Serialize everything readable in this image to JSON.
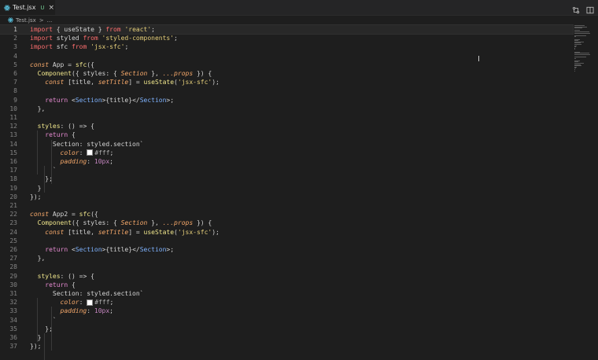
{
  "tab": {
    "filename": "Test.jsx",
    "status": "U",
    "close": "×",
    "icon": "react-icon"
  },
  "tab_actions": [
    {
      "icon": "compare-changes-icon"
    },
    {
      "icon": "split-editor-icon"
    }
  ],
  "breadcrumb": {
    "icon": "react-icon",
    "filename": "Test.jsx",
    "separator": ">",
    "more": "..."
  },
  "editor": {
    "current_line": 1
  },
  "lines": [
    [
      [
        "kw",
        "import"
      ],
      [
        "var",
        " { useState } "
      ],
      [
        "kw",
        "from"
      ],
      [
        "var",
        " "
      ],
      [
        "str",
        "'react'"
      ],
      [
        "var",
        ";"
      ]
    ],
    [
      [
        "kw",
        "import"
      ],
      [
        "var",
        " styled "
      ],
      [
        "kw",
        "from"
      ],
      [
        "var",
        " "
      ],
      [
        "str",
        "'styled-components'"
      ],
      [
        "var",
        ";"
      ]
    ],
    [
      [
        "kw",
        "import"
      ],
      [
        "var",
        " sfc "
      ],
      [
        "kw",
        "from"
      ],
      [
        "var",
        " "
      ],
      [
        "str",
        "'jsx-sfc'"
      ],
      [
        "var",
        ";"
      ]
    ],
    [],
    [
      [
        "it",
        "const"
      ],
      [
        "var",
        " App = "
      ],
      [
        "fn",
        "sfc"
      ],
      [
        "var",
        "({"
      ]
    ],
    [
      [
        "var",
        "  "
      ],
      [
        "fn",
        "Component"
      ],
      [
        "var",
        "({ styles: { "
      ],
      [
        "it",
        "Section"
      ],
      [
        "var",
        " }, "
      ],
      [
        "it",
        "...props"
      ],
      [
        "var",
        " }) {"
      ]
    ],
    [
      [
        "var",
        "    "
      ],
      [
        "it",
        "const"
      ],
      [
        "var",
        " [title, "
      ],
      [
        "it",
        "setTitle"
      ],
      [
        "var",
        "] = "
      ],
      [
        "fn",
        "useState"
      ],
      [
        "var",
        "("
      ],
      [
        "str",
        "'jsx-sfc'"
      ],
      [
        "var",
        ");"
      ]
    ],
    [],
    [
      [
        "var",
        "    "
      ],
      [
        "ctl",
        "return"
      ],
      [
        "var",
        " <"
      ],
      [
        "tag",
        "Section"
      ],
      [
        "var",
        ">{title}</"
      ],
      [
        "tag",
        "Section"
      ],
      [
        "var",
        ">;"
      ]
    ],
    [
      [
        "var",
        "  },"
      ]
    ],
    [],
    [
      [
        "var",
        "  "
      ],
      [
        "fn",
        "styles"
      ],
      [
        "var",
        ": () => {"
      ]
    ],
    [
      [
        "var",
        "    "
      ],
      [
        "ctl",
        "return"
      ],
      [
        "var",
        " {"
      ]
    ],
    [
      [
        "var",
        "      Section: styled.section`"
      ]
    ],
    [
      [
        "var",
        "        "
      ],
      [
        "it",
        "color"
      ],
      [
        "var",
        ": "
      ],
      [
        "swatch",
        ""
      ],
      [
        "cp",
        "#fff"
      ],
      [
        "var",
        ";"
      ]
    ],
    [
      [
        "var",
        "        "
      ],
      [
        "it",
        "padding"
      ],
      [
        "var",
        ": "
      ],
      [
        "num",
        "10px"
      ],
      [
        "var",
        ";"
      ]
    ],
    [
      [
        "var",
        "      `"
      ]
    ],
    [
      [
        "var",
        "    };"
      ]
    ],
    [
      [
        "var",
        "  }"
      ]
    ],
    [
      [
        "var",
        "});"
      ]
    ],
    [],
    [
      [
        "it",
        "const"
      ],
      [
        "var",
        " App2 = "
      ],
      [
        "fn",
        "sfc"
      ],
      [
        "var",
        "({"
      ]
    ],
    [
      [
        "var",
        "  "
      ],
      [
        "fn",
        "Component"
      ],
      [
        "var",
        "({ styles: { "
      ],
      [
        "it",
        "Section"
      ],
      [
        "var",
        " }, "
      ],
      [
        "it",
        "...props"
      ],
      [
        "var",
        " }) {"
      ]
    ],
    [
      [
        "var",
        "    "
      ],
      [
        "it",
        "const"
      ],
      [
        "var",
        " [title, "
      ],
      [
        "it",
        "setTitle"
      ],
      [
        "var",
        "] = "
      ],
      [
        "fn",
        "useState"
      ],
      [
        "var",
        "("
      ],
      [
        "str",
        "'jsx-sfc'"
      ],
      [
        "var",
        ");"
      ]
    ],
    [],
    [
      [
        "var",
        "    "
      ],
      [
        "ctl",
        "return"
      ],
      [
        "var",
        " <"
      ],
      [
        "tag",
        "Section"
      ],
      [
        "var",
        ">{title}</"
      ],
      [
        "tag",
        "Section"
      ],
      [
        "var",
        ">;"
      ]
    ],
    [
      [
        "var",
        "  },"
      ]
    ],
    [],
    [
      [
        "var",
        "  "
      ],
      [
        "fn",
        "styles"
      ],
      [
        "var",
        ": () => {"
      ]
    ],
    [
      [
        "var",
        "    "
      ],
      [
        "ctl",
        "return"
      ],
      [
        "var",
        " {"
      ]
    ],
    [
      [
        "var",
        "      Section: styled.section`"
      ]
    ],
    [
      [
        "var",
        "        "
      ],
      [
        "it",
        "color"
      ],
      [
        "var",
        ": "
      ],
      [
        "swatch",
        ""
      ],
      [
        "cp",
        "#fff"
      ],
      [
        "var",
        ";"
      ]
    ],
    [
      [
        "var",
        "        "
      ],
      [
        "it",
        "padding"
      ],
      [
        "var",
        ": "
      ],
      [
        "num",
        "10px"
      ],
      [
        "var",
        ";"
      ]
    ],
    [
      [
        "var",
        "      `"
      ]
    ],
    [
      [
        "var",
        "    };"
      ]
    ],
    [
      [
        "var",
        "  }"
      ]
    ],
    [
      [
        "var",
        "});"
      ]
    ]
  ]
}
